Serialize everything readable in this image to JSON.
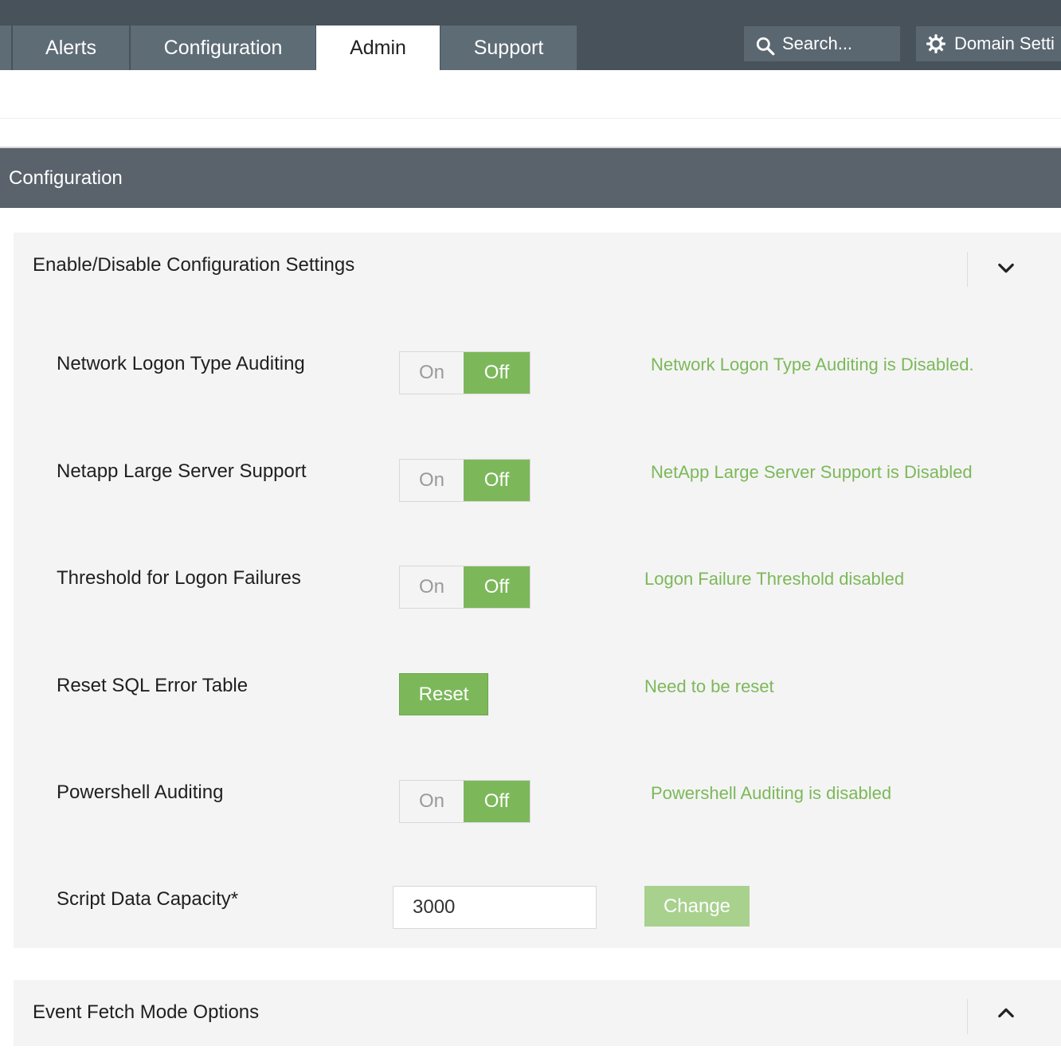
{
  "nav": {
    "tabs": [
      {
        "label": "Alerts"
      },
      {
        "label": "Configuration"
      },
      {
        "label": "Admin",
        "active": true
      },
      {
        "label": "Support"
      }
    ],
    "search_placeholder": "Search...",
    "domain_settings_label": "Domain Setti"
  },
  "section": {
    "title": "Configuration"
  },
  "panel_config": {
    "title": "Enable/Disable Configuration Settings",
    "rows": [
      {
        "label": "Network Logon Type Auditing",
        "on_label": "On",
        "off_label": "Off",
        "state": "Off",
        "status": "Network Logon Type Auditing is Disabled."
      },
      {
        "label": "Netapp Large Server Support",
        "on_label": "On",
        "off_label": "Off",
        "state": "Off",
        "status": "NetApp Large Server Support is Disabled"
      },
      {
        "label": "Threshold for Logon Failures",
        "on_label": "On",
        "off_label": "Off",
        "state": "Off",
        "status": "Logon Failure Threshold disabled"
      },
      {
        "label": "Reset SQL Error Table",
        "button_label": "Reset",
        "status": "Need to be reset"
      },
      {
        "label": "Powershell Auditing",
        "on_label": "On",
        "off_label": "Off",
        "state": "Off",
        "status": "Powershell Auditing is disabled"
      },
      {
        "label": "Script Data Capacity*",
        "value": "3000",
        "button_label": "Change"
      }
    ]
  },
  "panel_fetch": {
    "title": "Event Fetch Mode Options"
  },
  "colors": {
    "accent_green": "#7cb85a",
    "nav_bg": "#47525a",
    "header_bg": "#5a636b"
  }
}
